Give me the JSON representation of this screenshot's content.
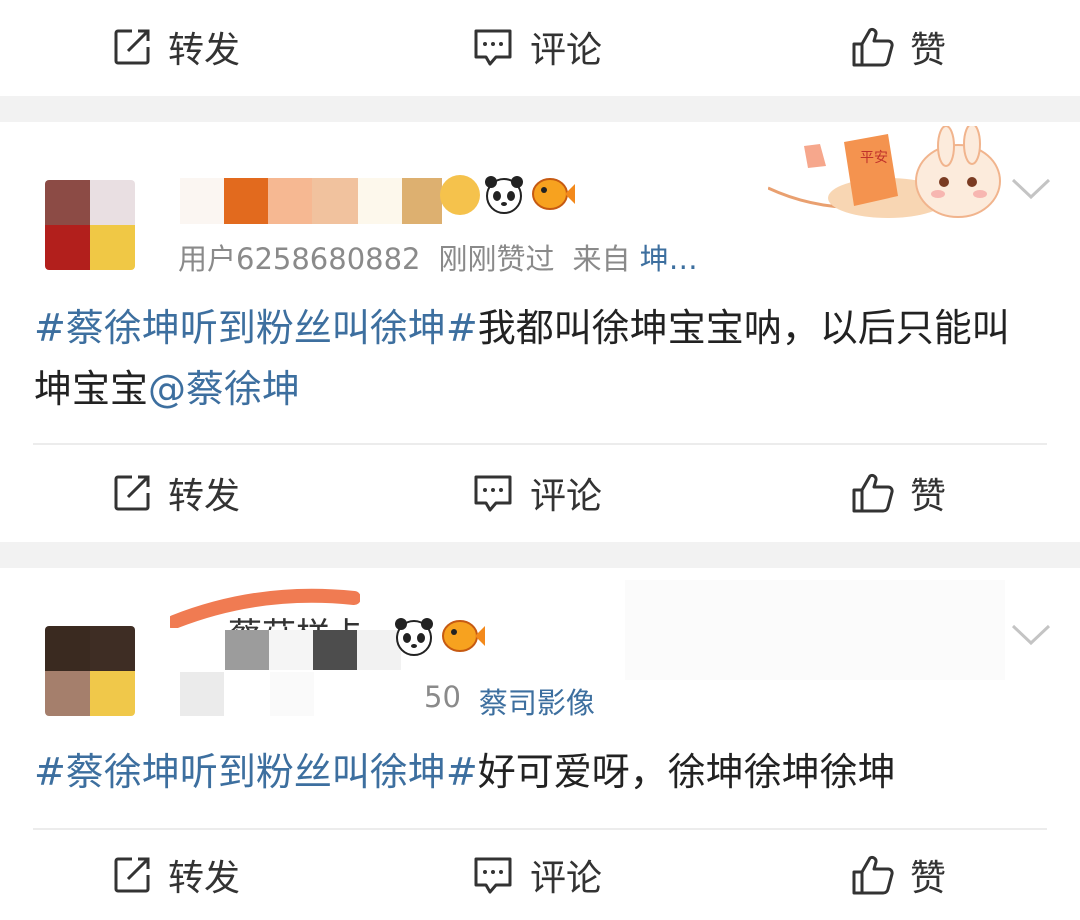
{
  "actions": {
    "forward_label": "转发",
    "comment_label": "评论",
    "like_label": "赞"
  },
  "post1": {
    "meta_user": "用户6258680882",
    "meta_time": "刚刚赞过",
    "meta_source_prefix": "来自",
    "meta_source": "坤…",
    "hashtag": "#蔡徐坤听到粉丝叫徐坤#",
    "text": "我都叫徐坤宝宝呐，以后只能叫坤宝宝",
    "mention": "@蔡徐坤",
    "sticker_text": "平安"
  },
  "post2": {
    "name_partial": "蔡菇样卡",
    "meta_partial": "50",
    "meta_source": "蔡司影像",
    "hashtag": "#蔡徐坤听到粉丝叫徐坤#",
    "text": "好可爱呀，徐坤徐坤徐坤"
  },
  "colors": {
    "link_blue": "#3d6f9f",
    "separator": "#f2f2f2"
  }
}
